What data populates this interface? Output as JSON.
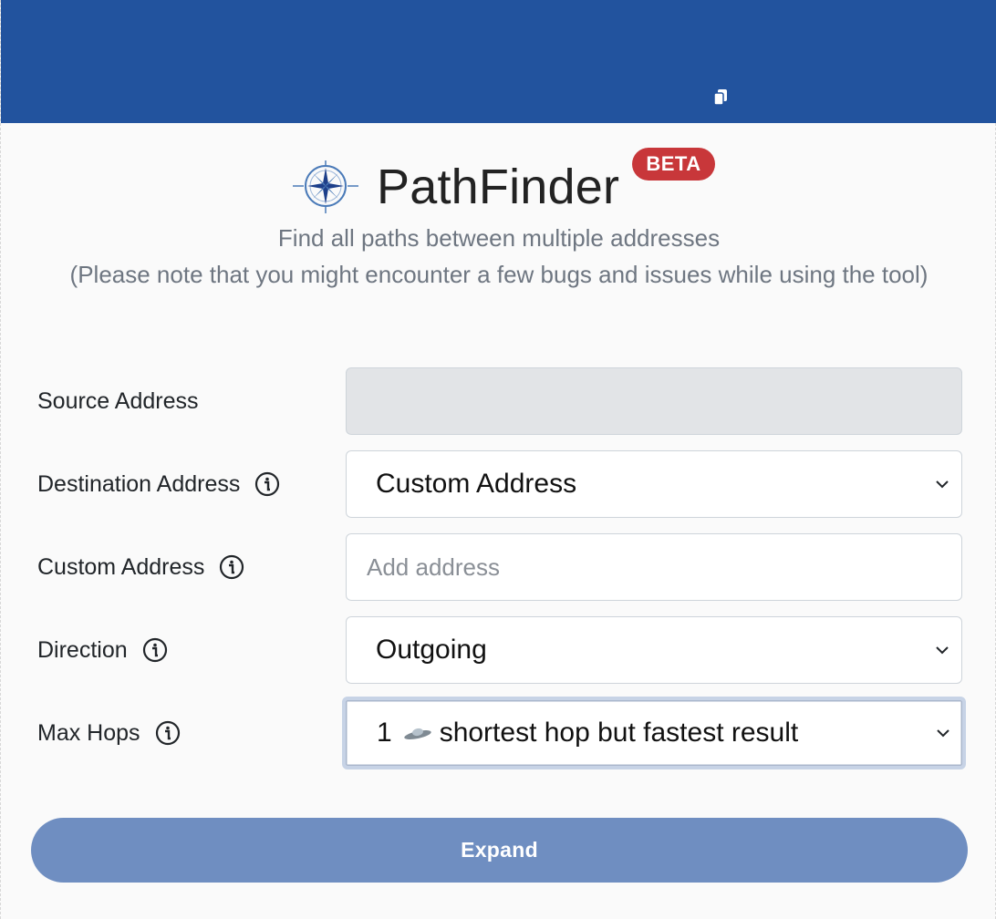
{
  "header": {
    "icons": [
      "copy-icon"
    ]
  },
  "brand": {
    "title": "PathFinder",
    "badge": "BETA",
    "logo_icon": "compass-icon"
  },
  "subtitle": {
    "line1": "Find all paths between multiple addresses",
    "line2": "(Please note that you might encounter a few bugs and issues while using the tool)"
  },
  "form": {
    "source": {
      "label": "Source Address",
      "value": ""
    },
    "destination": {
      "label": "Destination Address",
      "value": "Custom Address",
      "icon": "info-icon"
    },
    "custom": {
      "label": "Custom Address",
      "placeholder": "Add address",
      "value": "",
      "icon": "info-icon"
    },
    "direction": {
      "label": "Direction",
      "value": "Outgoing",
      "icon": "info-icon"
    },
    "max_hops": {
      "label": "Max Hops",
      "number": "1",
      "emoji_icon": "ufo-icon",
      "text": "shortest hop but fastest result",
      "icon": "info-icon"
    }
  },
  "actions": {
    "expand_label": "Expand"
  },
  "colors": {
    "header_bg": "#22539e",
    "badge_bg": "#c8373a",
    "button_bg": "#6f8ec1"
  }
}
